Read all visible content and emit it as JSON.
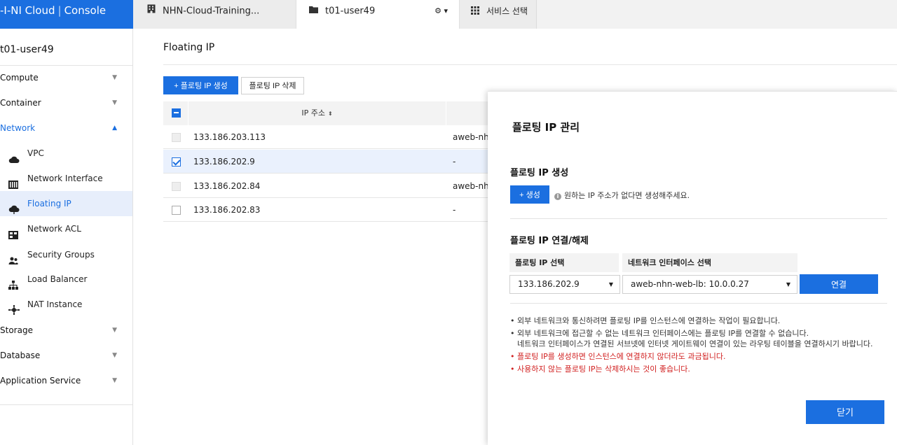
{
  "header": {
    "brand_logo": "-I-NI Cloud",
    "brand_sep": "|",
    "brand_product": "Console",
    "tabs": [
      {
        "label": "NHN-Cloud-Training...",
        "icon": "building-icon"
      },
      {
        "label": "t01-user49",
        "icon": "folder-icon",
        "tools": "⚙ ▾"
      },
      {
        "label": "서비스 선택",
        "icon": "grid-icon"
      }
    ]
  },
  "sidebar": {
    "project": "t01-user49",
    "groups": [
      {
        "label": "Compute",
        "caret": "▼"
      },
      {
        "label": "Container",
        "caret": "▼"
      },
      {
        "label": "Network",
        "caret": "▲"
      },
      {
        "label": "Storage",
        "caret": "▼"
      },
      {
        "label": "Database",
        "caret": "▼"
      },
      {
        "label": "Application Service",
        "caret": "▼"
      }
    ],
    "network_items": [
      {
        "label": "VPC",
        "icon": "cloud-icon"
      },
      {
        "label": "Network Interface",
        "icon": "network-card-icon"
      },
      {
        "label": "Floating IP",
        "icon": "cloud-upload-icon"
      },
      {
        "label": "Network ACL",
        "icon": "acl-icon"
      },
      {
        "label": "Security Groups",
        "icon": "users-icon"
      },
      {
        "label": "Load Balancer",
        "icon": "sitemap-icon"
      },
      {
        "label": "NAT Instance",
        "icon": "nat-icon"
      }
    ]
  },
  "main": {
    "title": "Floating IP",
    "create_button": "+ 플로팅 IP 생성",
    "delete_button": "플로팅 IP 삭제",
    "table": {
      "header_ip": "IP 주소",
      "sort_icon": "⬍",
      "rows": [
        {
          "ip": "133.186.203.113",
          "iface": "aweb-nhn",
          "state": "disabled"
        },
        {
          "ip": "133.186.202.9",
          "iface": "-",
          "state": "checked"
        },
        {
          "ip": "133.186.202.84",
          "iface": "aweb-nhn",
          "state": "disabled"
        },
        {
          "ip": "133.186.202.83",
          "iface": "-",
          "state": "unchecked"
        }
      ]
    }
  },
  "modal": {
    "title": "플로팅 IP 관리",
    "create_heading": "플로팅 IP 생성",
    "create_button": "+ 생성",
    "info_icon": "i",
    "create_info": "원하는 IP 주소가 없다면 생성해주세요.",
    "connect_heading": "플로팅 IP 연결/해제",
    "col_floating": "플로팅 IP 선택",
    "col_iface": "네트워크 인터페이스 선택",
    "select_floating": "133.186.202.9",
    "select_iface": "aweb-nhn-web-lb: 10.0.0.27",
    "select_arrow": "▼",
    "connect_button": "연결",
    "notes": [
      "외부 네트워크와 통신하려면 플로팅 IP를 인스턴스에 연결하는 작업이 필요합니다.",
      "외부 네트워크에 접근할 수 없는 네트워크 인터페이스에는 플로팅 IP를 연결할 수 없습니다.",
      "네트워크 인터페이스가 연결된 서브넷에 인터넷 게이트웨이 연결이 있는 라우팅 테이블을 연결하시기 바랍니다.",
      "플로팅 IP를 생성하면 인스턴스에 연결하지 않더라도 과금됩니다.",
      "사용하지 않는 플로팅 IP는 삭제하시는 것이 좋습니다."
    ],
    "close_button": "닫기"
  },
  "colors": {
    "accent": "#1b6fe0",
    "warning": "#d12020",
    "selected_row": "#eaf1fd"
  }
}
